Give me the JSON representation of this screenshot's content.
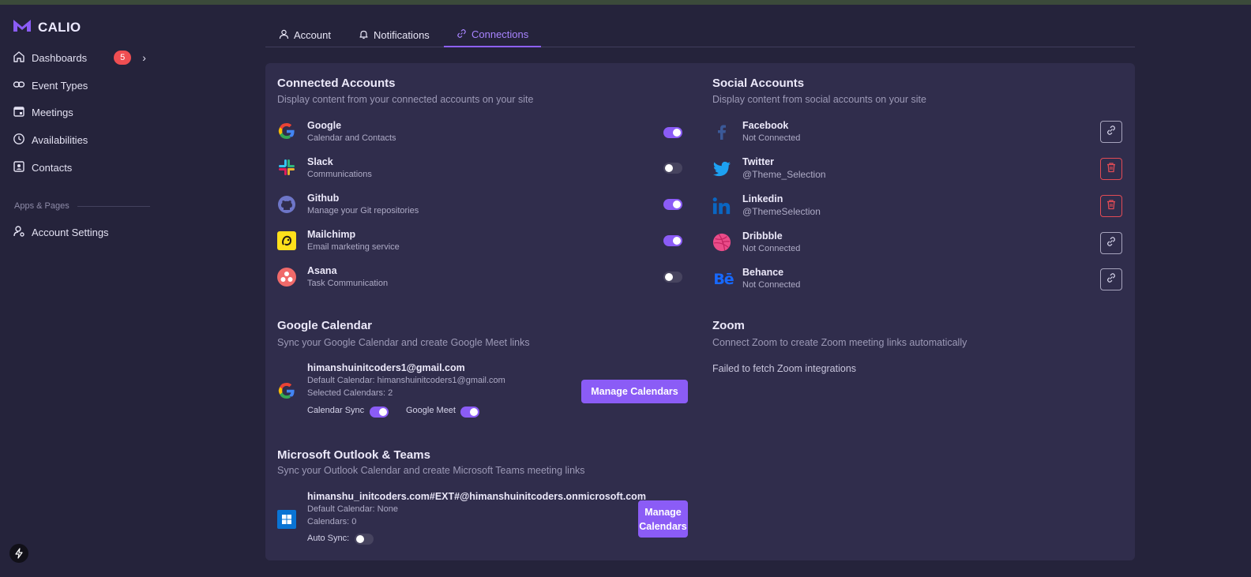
{
  "app": {
    "brand": "CALIO"
  },
  "sidebar": {
    "items": [
      {
        "label": "Dashboards",
        "badge": "5",
        "icon": "home-icon"
      },
      {
        "label": "Event Types",
        "icon": "link-icon"
      },
      {
        "label": "Meetings",
        "icon": "calendar-icon"
      },
      {
        "label": "Availabilities",
        "icon": "clock-icon"
      },
      {
        "label": "Contacts",
        "icon": "contact-card-icon"
      }
    ],
    "section_label": "Apps & Pages",
    "settings_label": "Account Settings"
  },
  "tabs": [
    {
      "label": "Account",
      "icon": "user-icon"
    },
    {
      "label": "Notifications",
      "icon": "bell-icon"
    },
    {
      "label": "Connections",
      "icon": "link-icon",
      "active": true
    }
  ],
  "connected": {
    "title": "Connected Accounts",
    "subtitle": "Display content from your connected accounts on your site",
    "items": [
      {
        "name": "Google",
        "desc": "Calendar and Contacts",
        "enabled": true
      },
      {
        "name": "Slack",
        "desc": "Communications",
        "enabled": false
      },
      {
        "name": "Github",
        "desc": "Manage your Git repositories",
        "enabled": true
      },
      {
        "name": "Mailchimp",
        "desc": "Email marketing service",
        "enabled": true
      },
      {
        "name": "Asana",
        "desc": "Task Communication",
        "enabled": false
      }
    ]
  },
  "social": {
    "title": "Social Accounts",
    "subtitle": "Display content from social accounts on your site",
    "items": [
      {
        "name": "Facebook",
        "status": "Not Connected",
        "action": "link"
      },
      {
        "name": "Twitter",
        "status": "@Theme_Selection",
        "action": "delete"
      },
      {
        "name": "Linkedin",
        "status": "@ThemeSelection",
        "action": "delete"
      },
      {
        "name": "Dribbble",
        "status": "Not Connected",
        "action": "link"
      },
      {
        "name": "Behance",
        "status": "Not Connected",
        "action": "link"
      }
    ]
  },
  "google_calendar": {
    "title": "Google Calendar",
    "subtitle": "Sync your Google Calendar and create Google Meet links",
    "email": "himanshuinitcoders1@gmail.com",
    "default_calendar": "Default Calendar: himanshuinitcoders1@gmail.com",
    "selected": "Selected Calendars: 2",
    "calendar_sync_label": "Calendar Sync",
    "calendar_sync": true,
    "google_meet_label": "Google Meet",
    "google_meet": true,
    "button": "Manage Calendars"
  },
  "zoom": {
    "title": "Zoom",
    "subtitle": "Connect Zoom to create Zoom meeting links automatically",
    "message": "Failed to fetch Zoom integrations"
  },
  "outlook": {
    "title": "Microsoft Outlook & Teams",
    "subtitle": "Sync your Outlook Calendar and create Microsoft Teams meeting links",
    "email": "himanshu_initcoders.com#EXT#@himanshuinitcoders.onmicrosoft.com",
    "default_calendar": "Default Calendar: None",
    "calendars": "Calendars: 0",
    "auto_sync_label": "Auto Sync:",
    "auto_sync": false,
    "button_line1": "Manage",
    "button_line2": "Calendars"
  },
  "colors": {
    "accent": "#8b5cf6",
    "background": "#25233b",
    "card": "#302d4c",
    "danger": "#e24b55"
  }
}
